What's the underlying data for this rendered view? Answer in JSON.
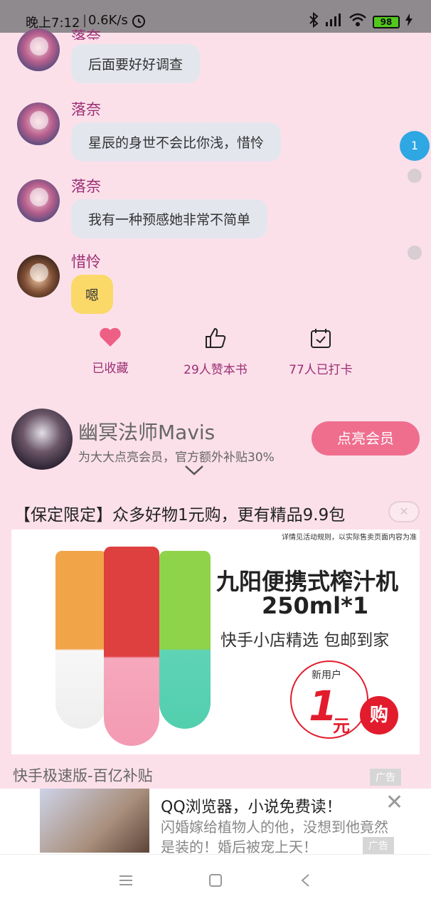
{
  "status_bar": {
    "time": "晚上7:12",
    "separator": "|",
    "speed": "0.6K/s",
    "battery": "98",
    "icons": [
      "alarm-icon",
      "bluetooth-icon",
      "hd-signal-icon",
      "wifi-icon",
      "battery-icon",
      "charging-icon"
    ]
  },
  "chat": {
    "messages": [
      {
        "name": "落奈",
        "text": "后面要好好调查"
      },
      {
        "name": "落奈",
        "text": "星辰的身世不会比你浅，惜怜"
      },
      {
        "name": "落奈",
        "text": "我有一种预感她非常不简单"
      },
      {
        "name": "惜怜",
        "text": "嗯"
      }
    ],
    "unread_badge": "1"
  },
  "actions": {
    "favorite": "已收藏",
    "like": "29人赞本书",
    "checkin": "77人已打卡"
  },
  "member": {
    "title": "幽冥法师Mavis",
    "subtitle": "为大大点亮会员，官方额外补贴30%",
    "button": "点亮会员"
  },
  "ad1": {
    "title": "【保定限定】众多好物1元购，更有精品9.9包",
    "close": "✕",
    "fine_print": "详情见活动规则，以实际售卖页面内容为准",
    "headline1": "九阳便携式榨汁机",
    "headline2": "250ml*1",
    "tagline": "快手小店精选  包邮到家",
    "new_user": "新用户",
    "price": "1",
    "price_unit": "元",
    "buy": "购",
    "footer": "快手极速版-百亿补贴",
    "ad_tag": "广告"
  },
  "ad2": {
    "title": "QQ浏览器，小说免费读！",
    "desc": "闪婚嫁给植物人的他，没想到他竟然是装的！婚后被宠上天！",
    "ad_tag": "广告",
    "close": "✕"
  },
  "colors": {
    "background": "#fbe0ea",
    "accent": "#9c2e73",
    "button": "#ef6e8e",
    "badge": "#2ea7e3"
  }
}
